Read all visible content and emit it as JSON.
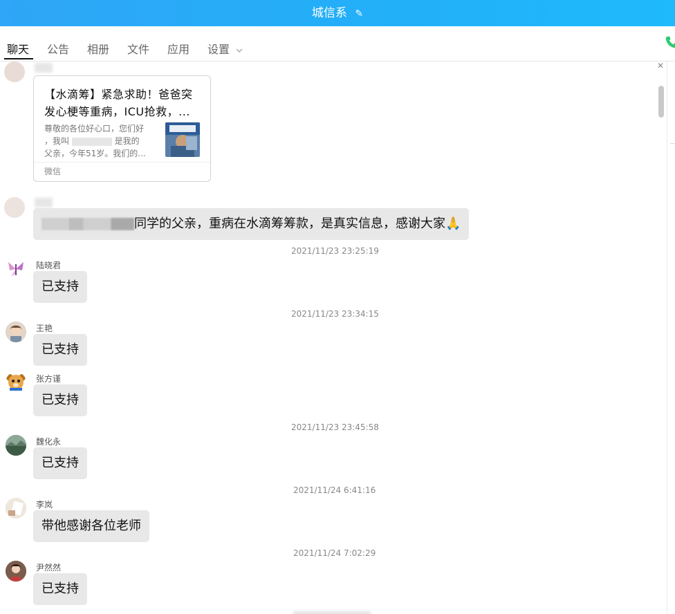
{
  "window": {
    "title": "城信系"
  },
  "tabs": [
    {
      "label": "聊天"
    },
    {
      "label": "公告"
    },
    {
      "label": "相册"
    },
    {
      "label": "文件"
    },
    {
      "label": "应用"
    },
    {
      "label": "设置"
    }
  ],
  "link_card": {
    "title": "【水滴筹】紧急求助！爸爸突发心梗等重病，ICU抢救，...",
    "desc_line1": "尊敬的各位好心口，您们好",
    "desc_line2": "，我叫",
    "desc_line2b": "是我的",
    "desc_line3": "父亲，今年51岁。我们的...",
    "source": "微信"
  },
  "messages": [
    {
      "text": "同学的父亲，重病在水滴筹筹款，是真实信息，感谢大家🙏"
    },
    {
      "timestamp": "2021/11/23 23:25:19",
      "name": "陆晓君",
      "text": "已支持"
    },
    {
      "timestamp": "2021/11/23 23:34:15",
      "name": "王艳",
      "text": "已支持"
    },
    {
      "name": "张方谨",
      "text": "已支持"
    },
    {
      "timestamp": "2021/11/23 23:45:58",
      "name": "魏化永",
      "text": "已支持"
    },
    {
      "timestamp": "2021/11/24 6:41:16",
      "name": "李岚",
      "text": "带他感谢各位老师"
    },
    {
      "timestamp": "2021/11/24 7:02:29",
      "name": "尹然然",
      "text": "已支持"
    }
  ],
  "colors": {
    "titlebar": "#2fa6f7",
    "bubble": "#e8e8e8",
    "call_icon": "#2ecc71"
  }
}
